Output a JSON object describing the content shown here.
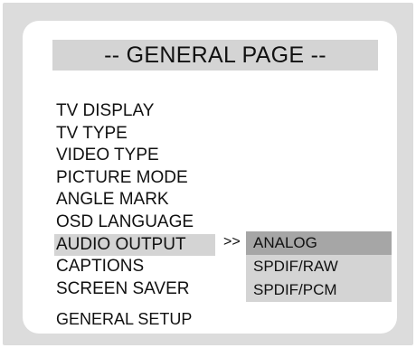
{
  "page": {
    "title": "-- GENERAL PAGE --",
    "footer": "GENERAL SETUP"
  },
  "menu": {
    "items": [
      {
        "label": "TV DISPLAY"
      },
      {
        "label": "TV TYPE"
      },
      {
        "label": "VIDEO TYPE"
      },
      {
        "label": "PICTURE MODE"
      },
      {
        "label": "ANGLE MARK"
      },
      {
        "label": "OSD LANGUAGE"
      },
      {
        "label": "AUDIO OUTPUT",
        "selected": true
      },
      {
        "label": "CAPTIONS"
      },
      {
        "label": "SCREEN SAVER"
      }
    ],
    "submenu_arrow": ">>"
  },
  "submenu": {
    "parent": "AUDIO OUTPUT",
    "options": [
      {
        "label": "ANALOG",
        "selected": true
      },
      {
        "label": "SPDIF/RAW"
      },
      {
        "label": "SPDIF/PCM"
      }
    ]
  },
  "colors": {
    "outer_frame": "#dcdcdc",
    "panel": "#ffffff",
    "highlight": "#d4d4d4",
    "selected_option": "#a6a6a6",
    "text": "#111111"
  }
}
